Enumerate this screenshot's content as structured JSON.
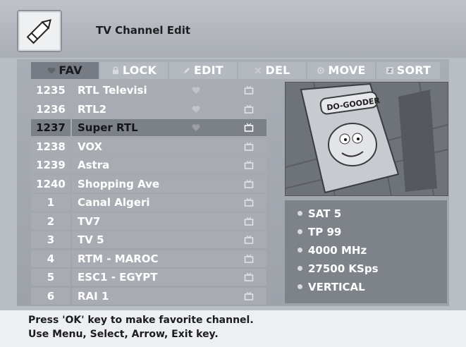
{
  "header": {
    "title": "TV Channel Edit",
    "logo_icon": "pencil-icon"
  },
  "tabs": [
    {
      "label": "FAV",
      "icon": "heart-icon",
      "active": true
    },
    {
      "label": "LOCK",
      "icon": "lock-icon",
      "active": false
    },
    {
      "label": "EDIT",
      "icon": "edit-icon",
      "active": false
    },
    {
      "label": "DEL",
      "icon": "delete-icon",
      "active": false
    },
    {
      "label": "MOVE",
      "icon": "move-icon",
      "active": false
    },
    {
      "label": "SORT",
      "icon": "sort-icon",
      "active": false
    }
  ],
  "channels": [
    {
      "num": "1235",
      "name": "RTL Televisi",
      "fav": true,
      "selected": false
    },
    {
      "num": "1236",
      "name": "RTL2",
      "fav": true,
      "selected": false
    },
    {
      "num": "1237",
      "name": "Super RTL",
      "fav": true,
      "selected": true
    },
    {
      "num": "1238",
      "name": "VOX",
      "fav": false,
      "selected": false
    },
    {
      "num": "1239",
      "name": "Astra",
      "fav": false,
      "selected": false
    },
    {
      "num": "1240",
      "name": "Shopping Ave",
      "fav": false,
      "selected": false
    },
    {
      "num": "1",
      "name": "Canal Algeri",
      "fav": false,
      "selected": false
    },
    {
      "num": "2",
      "name": "TV7",
      "fav": false,
      "selected": false
    },
    {
      "num": "3",
      "name": "TV 5",
      "fav": false,
      "selected": false
    },
    {
      "num": "4",
      "name": "RTM - MAROC",
      "fav": false,
      "selected": false
    },
    {
      "num": "5",
      "name": "ESC1 - EGYPT",
      "fav": false,
      "selected": false
    },
    {
      "num": "6",
      "name": "RAI 1",
      "fav": false,
      "selected": false
    }
  ],
  "preview": {
    "poster_text": "DO-GOODER"
  },
  "info": {
    "satellite": "SAT 5",
    "transponder": "TP 99",
    "frequency": "4000 MHz",
    "symbol_rate": "27500 KSps",
    "polarization": "VERTICAL"
  },
  "help": {
    "line1": "Press 'OK' key to make favorite channel.",
    "line2": "Use Menu, Select, Arrow, Exit key."
  }
}
